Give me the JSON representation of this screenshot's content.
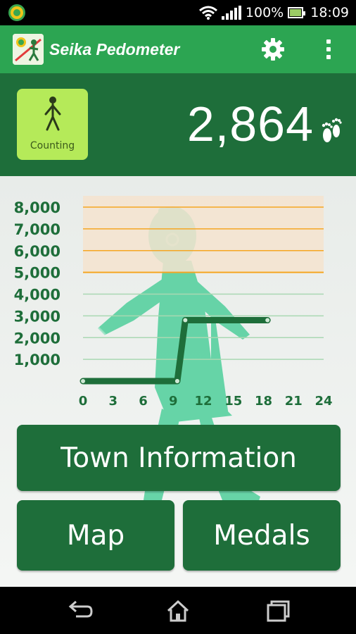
{
  "status_bar": {
    "app_icon": "seika-notification-icon",
    "battery_percent": "100%",
    "time": "18:09",
    "icons": [
      "wifi-icon",
      "signal-icon",
      "battery-icon"
    ]
  },
  "app_bar": {
    "title": "Seika Pedometer",
    "logo": "seika-logo-icon",
    "settings_icon": "gear-icon",
    "overflow_icon": "overflow-menu-icon",
    "color": "#2ca552"
  },
  "counter": {
    "status_label": "Counting",
    "steps": "2,864",
    "status_icon": "walking-person-icon",
    "steps_icon": "footprints-icon",
    "band_color": "#1e6e3a",
    "status_color": "#b5ea59"
  },
  "chart_data": {
    "type": "line",
    "x": [
      0,
      9.4,
      9.4,
      10.2,
      18.4
    ],
    "y": [
      0,
      0,
      0,
      2800,
      2800
    ],
    "xticks": [
      "0",
      "3",
      "6",
      "9",
      "12",
      "15",
      "18",
      "21",
      "24"
    ],
    "yticks": [
      "1,000",
      "2,000",
      "3,000",
      "4,000",
      "5,000",
      "6,000",
      "7,000",
      "8,000"
    ],
    "xlim": [
      0,
      24
    ],
    "ylim": [
      0,
      8000
    ],
    "goal": 5000,
    "goal_color": "#f5a623",
    "goal_zone_color": "#f5e3cf",
    "line_color": "#1e6e3a",
    "grid": true
  },
  "buttons": {
    "town_info": "Town Information",
    "map": "Map",
    "medals": "Medals"
  },
  "nav_bar": {
    "back_icon": "back-icon",
    "home_icon": "home-icon",
    "recents_icon": "recents-icon"
  }
}
